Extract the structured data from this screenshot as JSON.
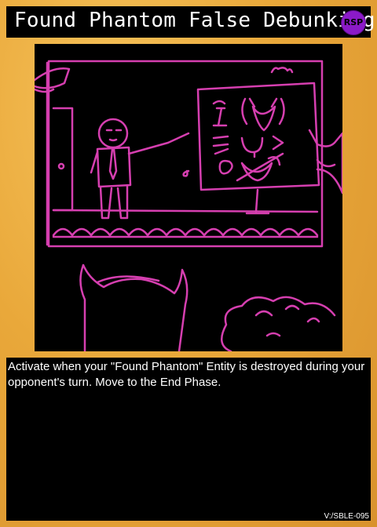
{
  "card": {
    "title": "Found Phantom False Debunking",
    "type_badge": "RSP",
    "effect_text": "Activate when your \"Found Phantom\" Entity is destroyed during your opponent's turn. Move to the End Phase.",
    "card_code": "V:/SBLE-095"
  },
  "colors": {
    "frame": "#e9a83a",
    "title_bar": "#000000",
    "badge": "#8b1ac8",
    "line_art": "#d63fb0"
  }
}
